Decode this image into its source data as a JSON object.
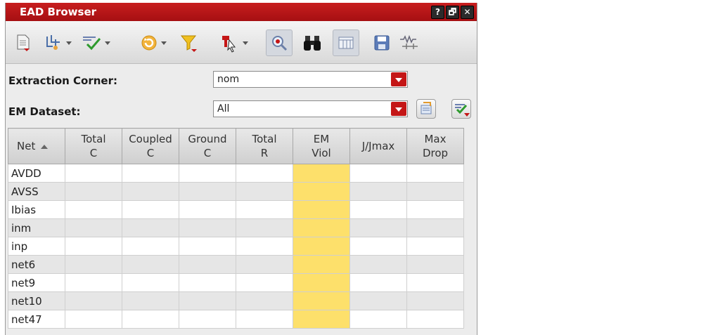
{
  "window": {
    "title": "EAD Browser",
    "buttons": [
      "?",
      "🗗",
      "✕"
    ]
  },
  "toolbar": {
    "icons": [
      "new-document-icon",
      "net-selection-icon",
      "check-icon",
      "refresh-icon",
      "filter-icon",
      "probe-cursor-icon",
      "zoom-icon",
      "binoculars-icon",
      "table-view-icon",
      "save-icon",
      "resistor-icon"
    ]
  },
  "form": {
    "extraction_corner": {
      "label": "Extraction Corner:",
      "value": "nom"
    },
    "em_dataset": {
      "label": "EM Dataset:",
      "value": "All"
    }
  },
  "table": {
    "headers": [
      {
        "line1": "Net",
        "line2": ""
      },
      {
        "line1": "Total",
        "line2": "C"
      },
      {
        "line1": "Coupled",
        "line2": "C"
      },
      {
        "line1": "Ground",
        "line2": "C"
      },
      {
        "line1": "Total",
        "line2": "R"
      },
      {
        "line1": "EM",
        "line2": "Viol"
      },
      {
        "line1": "J/Jmax",
        "line2": ""
      },
      {
        "line1": "Max",
        "line2": "Drop"
      }
    ],
    "rows": [
      "AVDD",
      "AVSS",
      "Ibias",
      "inm",
      "inp",
      "net6",
      "net9",
      "net10",
      "net47"
    ]
  },
  "colors": {
    "title_bar": "#b3151a",
    "em_highlight": "#fde06b",
    "combo_arrow": "#c41616"
  }
}
